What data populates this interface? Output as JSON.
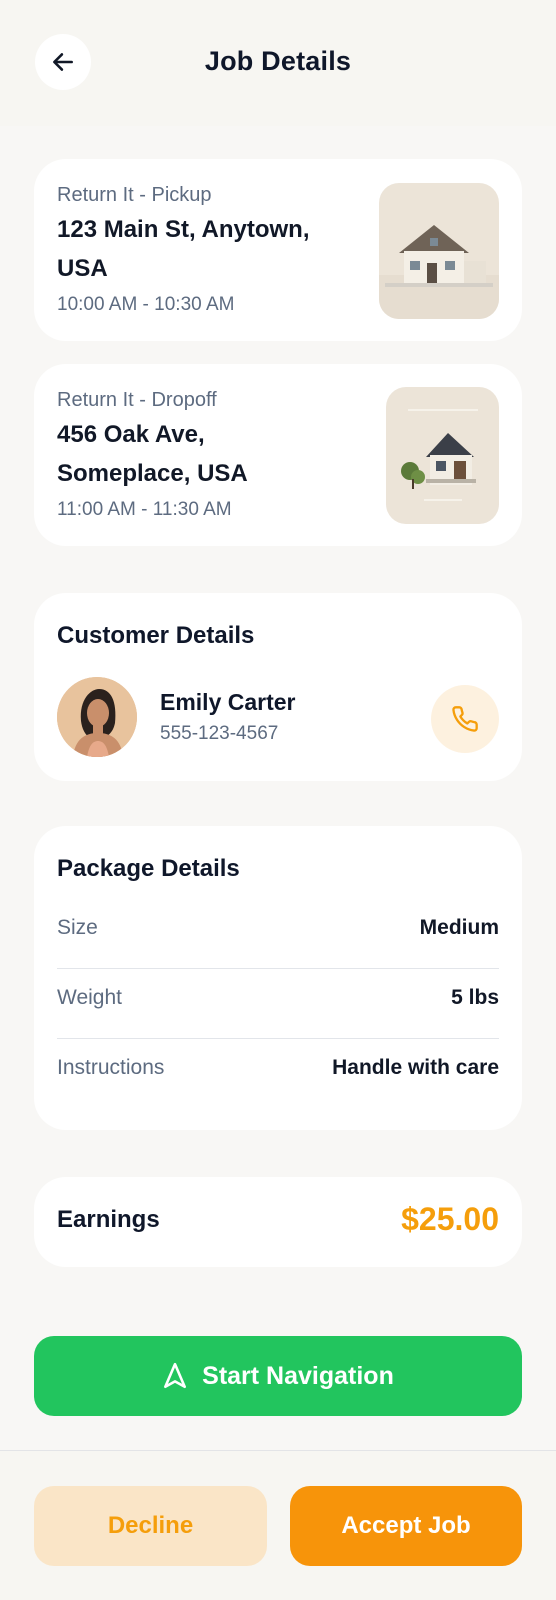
{
  "header": {
    "title": "Job Details",
    "back_icon": "arrow-left-icon"
  },
  "pickup": {
    "label": "Return It - Pickup",
    "address_line1": "123 Main St, Anytown,",
    "address_line2": "USA",
    "time": "10:00 AM - 10:30 AM"
  },
  "dropoff": {
    "label": "Return It - Dropoff",
    "address_line1": "456 Oak Ave,",
    "address_line2": "Someplace, USA",
    "time": "11:00 AM - 11:30 AM"
  },
  "customer": {
    "title": "Customer Details",
    "name": "Emily Carter",
    "phone": "555-123-4567",
    "call_icon": "phone-icon"
  },
  "package": {
    "title": "Package Details",
    "rows": [
      {
        "key": "Size",
        "value": "Medium"
      },
      {
        "key": "Weight",
        "value": "5 lbs"
      },
      {
        "key": "Instructions",
        "value": "Handle with care"
      }
    ]
  },
  "earnings": {
    "label": "Earnings",
    "value": "$25.00"
  },
  "actions": {
    "navigate_label": "Start Navigation",
    "navigate_icon": "navigation-arrow-icon",
    "decline_label": "Decline",
    "accept_label": "Accept Job"
  },
  "colors": {
    "accent": "#f7940a",
    "green": "#22c55e",
    "muted_text": "#5d6b80"
  }
}
